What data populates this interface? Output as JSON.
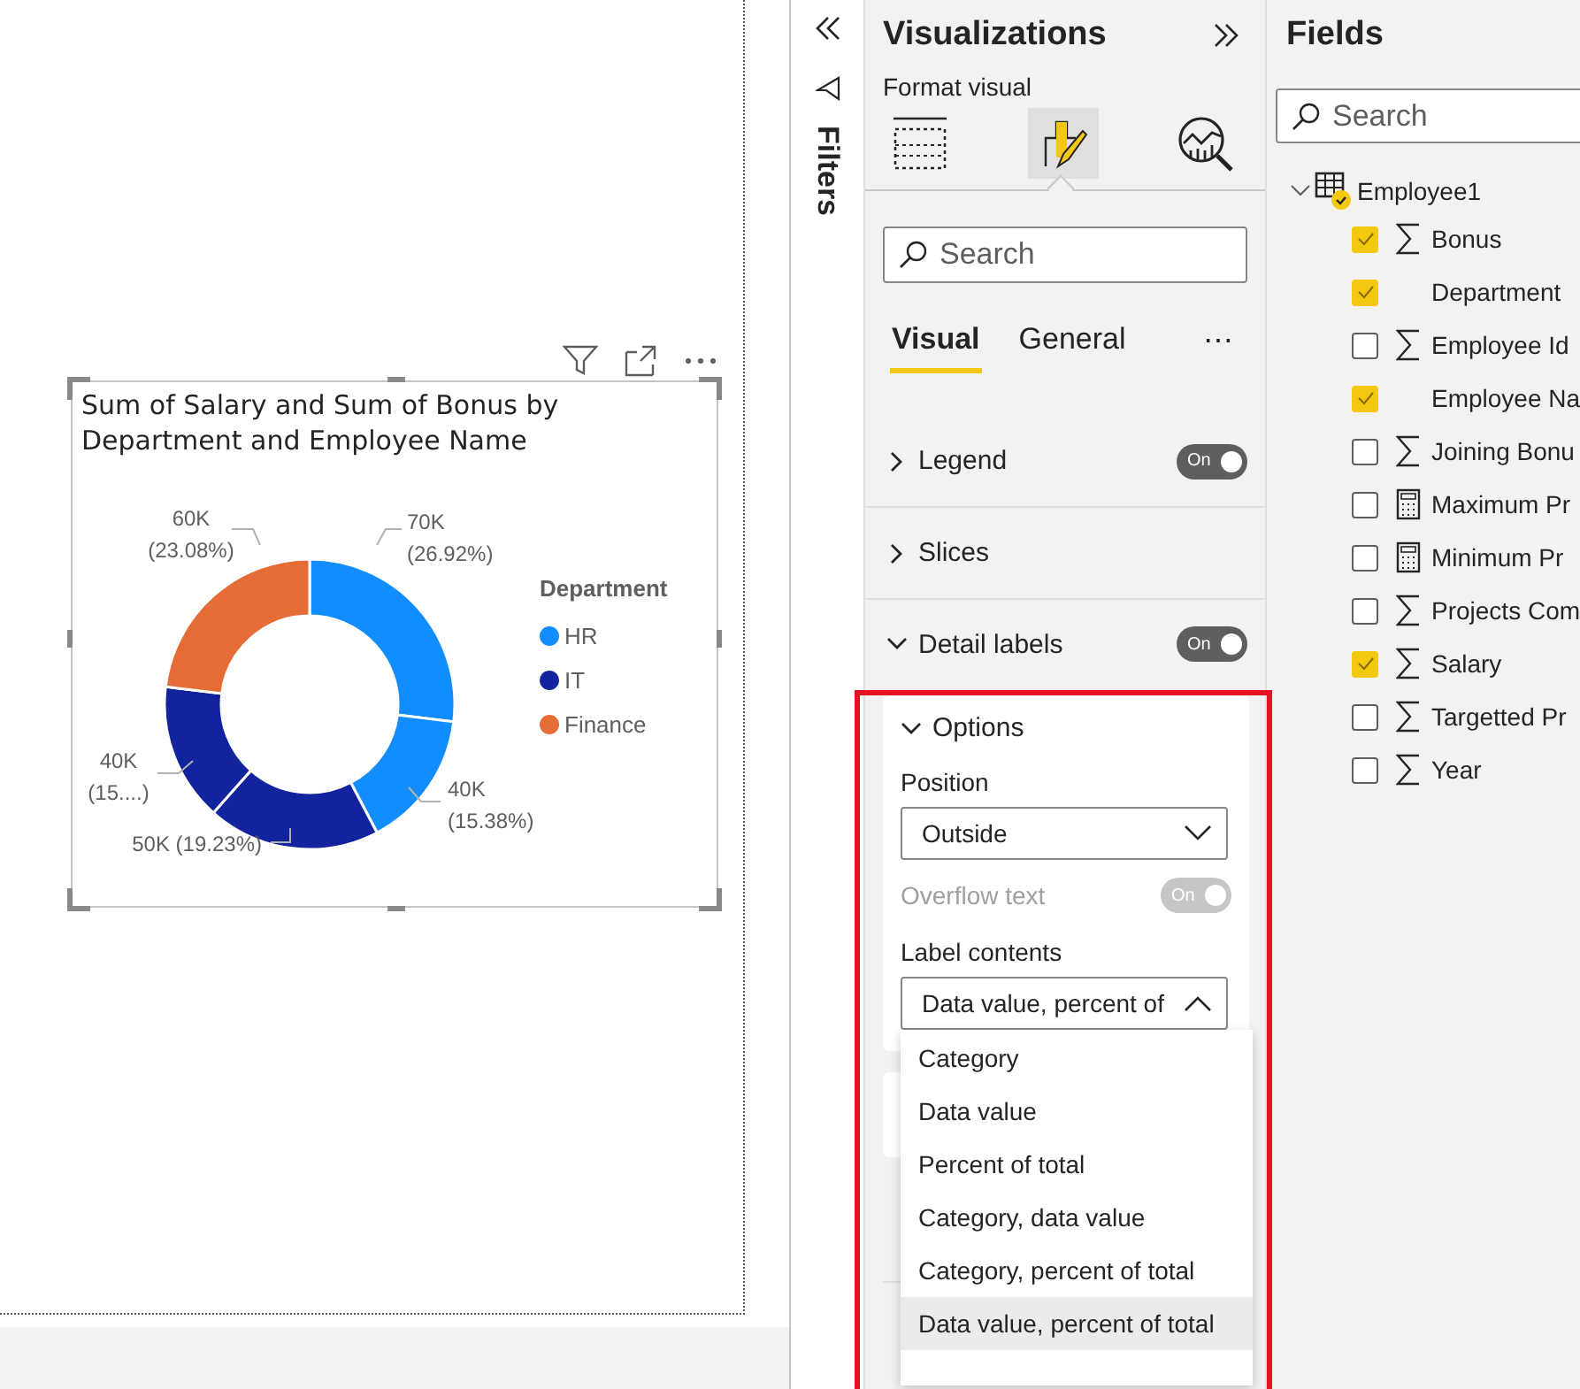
{
  "visual": {
    "title": "Sum of Salary and Sum of Bonus by Department and Employee Name",
    "chart_data": {
      "type": "donut",
      "values": [
        70000,
        40000,
        50000,
        40000,
        60000
      ],
      "colors": [
        "#118dff",
        "#118dff",
        "#12239e",
        "#12239e",
        "#e66c37"
      ],
      "value_labels": [
        "70K (26.92%)",
        "40K (15.38%)",
        "50K (19.23%)",
        "40K (15....)",
        "60K (23.08%)"
      ]
    },
    "legend": {
      "title": "Department",
      "items": [
        {
          "label": "HR",
          "color": "#118dff"
        },
        {
          "label": "IT",
          "color": "#12239e"
        },
        {
          "label": "Finance",
          "color": "#e66c37"
        }
      ]
    }
  },
  "filters": {
    "label": "Filters"
  },
  "visualizations": {
    "title": "Visualizations",
    "subtitle": "Format visual",
    "modes": [
      {
        "kind": "build",
        "selected": false
      },
      {
        "kind": "format",
        "selected": true
      },
      {
        "kind": "analytics",
        "selected": false
      }
    ],
    "search": {
      "placeholder": "Search"
    },
    "tabs": [
      {
        "label": "Visual",
        "selected": true
      },
      {
        "label": "General",
        "selected": false
      }
    ],
    "more": "⋯",
    "sections": [
      {
        "label": "Legend",
        "expanded": false,
        "toggle": "On",
        "on": true
      },
      {
        "label": "Slices",
        "expanded": false
      },
      {
        "label": "Detail labels",
        "expanded": true,
        "toggle": "On",
        "on": true
      }
    ],
    "options": {
      "title": "Options",
      "expanded": true,
      "position": {
        "label": "Position",
        "value": "Outside"
      },
      "overflow": {
        "label": "Overflow text",
        "toggle": "On",
        "on": true,
        "disabled": true
      },
      "label_contents": {
        "label": "Label contents",
        "value": "Data value, percent of",
        "expanded": true,
        "options": [
          {
            "label": "Category",
            "selected": false
          },
          {
            "label": "Data value",
            "selected": false
          },
          {
            "label": "Percent of total",
            "selected": false
          },
          {
            "label": "Category, data value",
            "selected": false
          },
          {
            "label": "Category, percent of total",
            "selected": false
          },
          {
            "label": "Data value, percent of total",
            "selected": true
          }
        ]
      }
    }
  },
  "fields": {
    "title": "Fields",
    "search": {
      "placeholder": "Search"
    },
    "table": {
      "name": "Employee1",
      "expanded": true,
      "children": [
        {
          "name": "Bonus",
          "kind": "sum",
          "checked": true
        },
        {
          "name": "Department",
          "kind": "text",
          "checked": true
        },
        {
          "name": "Employee Id",
          "kind": "sum",
          "checked": false
        },
        {
          "name": "Employee Na",
          "kind": "text",
          "checked": true
        },
        {
          "name": "Joining Bonu",
          "kind": "sum",
          "checked": false
        },
        {
          "name": "Maximum Pr",
          "kind": "measure",
          "checked": false
        },
        {
          "name": "Minimum Pr",
          "kind": "measure",
          "checked": false
        },
        {
          "name": "Projects Com",
          "kind": "sum",
          "checked": false
        },
        {
          "name": "Salary",
          "kind": "sum",
          "checked": true
        },
        {
          "name": "Targetted Pr",
          "kind": "sum",
          "checked": false
        },
        {
          "name": "Year",
          "kind": "sum",
          "checked": false
        }
      ]
    }
  }
}
